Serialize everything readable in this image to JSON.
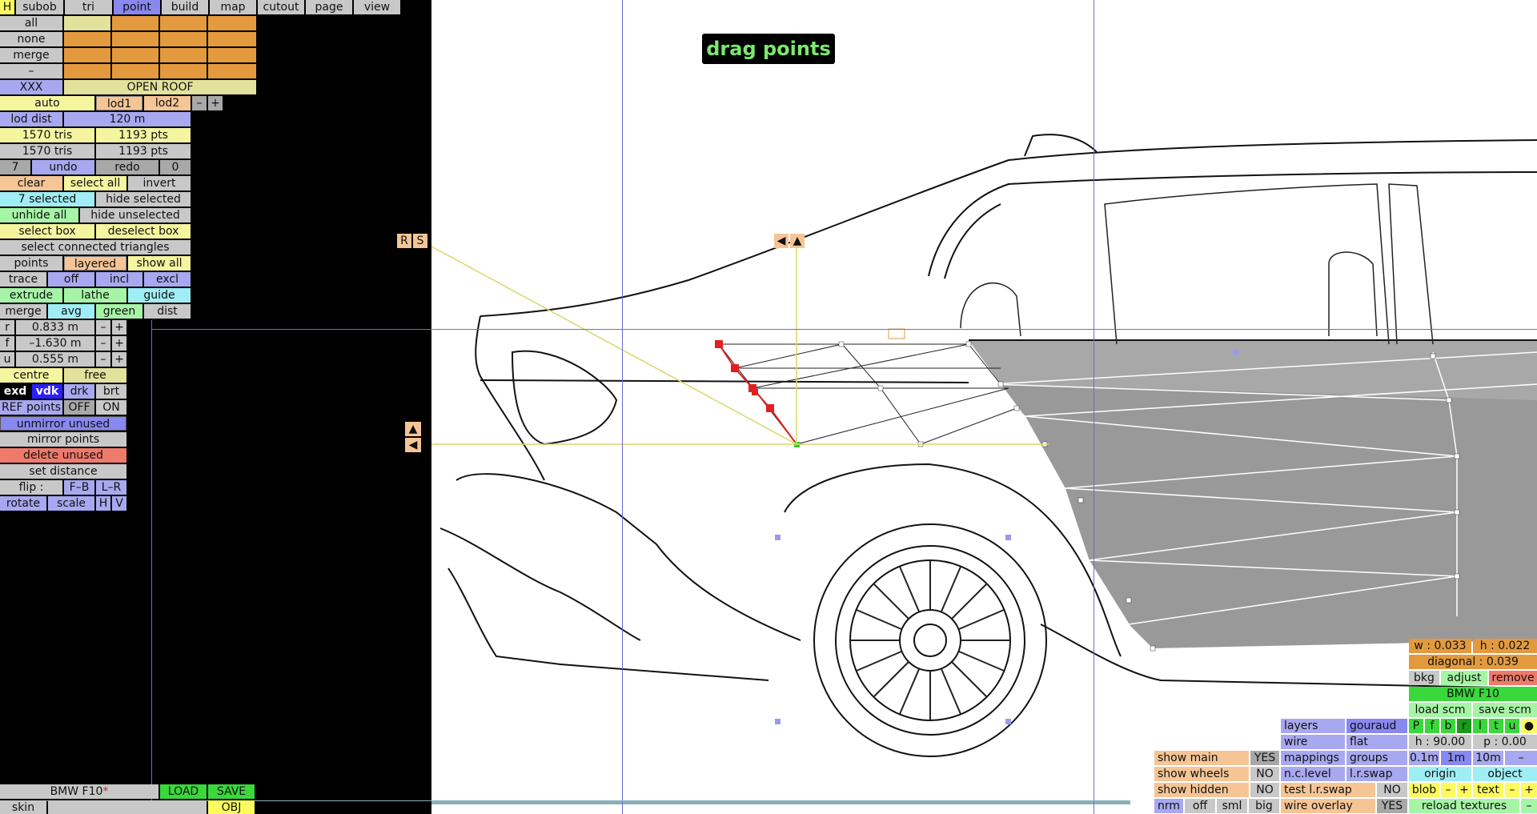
{
  "menu": {
    "h": "H",
    "tabs": [
      "subob",
      "tri",
      "point",
      "build",
      "map",
      "cutout",
      "page",
      "view"
    ],
    "active": "point"
  },
  "side": {
    "all": "all",
    "none": "none",
    "merge": "merge",
    "dash": "–",
    "xxx": "XXX",
    "open_roof": "OPEN ROOF",
    "auto": "auto",
    "lod1": "lod1",
    "lod2": "lod2",
    "minus": "–",
    "plus": "+",
    "lod_dist": "lod dist",
    "lod_dist_val": "120 m",
    "tris1": "1570 tris",
    "pts1": "1193 pts",
    "tris2": "1570 tris",
    "pts2": "1193 pts",
    "undo_n": "7",
    "undo": "undo",
    "redo": "redo",
    "redo_n": "0",
    "clear": "clear",
    "select_all": "select all",
    "invert": "invert",
    "selected": "7 selected",
    "hide_selected": "hide selected",
    "unhide_all": "unhide all",
    "hide_unselected": "hide unselected",
    "select_box": "select box",
    "deselect_box": "deselect box",
    "select_connected": "select connected triangles",
    "points": "points",
    "layered": "layered",
    "show_all": "show all",
    "trace": "trace",
    "off": "off",
    "incl": "incl",
    "excl": "excl",
    "extrude": "extrude",
    "lathe": "lathe",
    "guide": "guide",
    "merge2": "merge",
    "avg": "avg",
    "green": "green",
    "dist": "dist",
    "r": "r",
    "r_val": "0.833 m",
    "f": "f",
    "f_val": "–1.630 m",
    "u": "u",
    "u_val": "0.555 m",
    "centre": "centre",
    "free": "free",
    "exd": "exd",
    "vdk": "vdk",
    "drk": "drk",
    "brt": "brt",
    "ref_points": "REF points",
    "ref_off": "OFF",
    "ref_on": "ON",
    "unmirror": "unmirror unused",
    "mirror": "mirror points",
    "delete": "delete unused",
    "set_distance": "set distance",
    "flip": "flip :",
    "fb": "F–B",
    "lr": "L–R",
    "rotate": "rotate",
    "scale": "scale",
    "h": "H",
    "v": "V"
  },
  "bottom_left": {
    "model": "BMW F10",
    "modified_mark": "*",
    "load": "LOAD",
    "save": "SAVE",
    "skin": "skin",
    "obj": "OBJ"
  },
  "viewport": {
    "mode_label": "drag points",
    "rs_r": "R",
    "rs_s": "S",
    "arrow_left": "◀",
    "arrow_up": "▲"
  },
  "bottom_right": {
    "show_main": "show main",
    "show_main_v": "YES",
    "show_wheels": "show wheels",
    "show_wheels_v": "NO",
    "show_hidden": "show hidden",
    "show_hidden_v": "NO",
    "nrm": "nrm",
    "off": "off",
    "sml": "sml",
    "big": "big",
    "layers": "layers",
    "gouraud": "gouraud",
    "wire": "wire",
    "flat": "flat",
    "mappings": "mappings",
    "groups": "groups",
    "nc_level": "n.c.level",
    "lr_swap": "l.r.swap",
    "test_lr_swap": "test l.r.swap",
    "test_lr_swap_v": "NO",
    "wire_overlay": "wire overlay",
    "wire_overlay_v": "YES"
  },
  "right_panel": {
    "w": "w : 0.033",
    "h": "h : 0.022",
    "diagonal": "diagonal : 0.039",
    "bkg": "bkg",
    "adjust": "adjust",
    "remove": "remove",
    "model": "BMW F10",
    "load_scm": "load scm",
    "save_scm": "save scm",
    "views": [
      "P",
      "f",
      "b",
      "r",
      "l",
      "t",
      "u",
      "●"
    ],
    "h_val": "h : 90.00",
    "p_val": "p : 0.00",
    "steps": [
      "0.1m",
      "1m",
      "10m",
      "–"
    ],
    "origin": "origin",
    "object": "object",
    "blob": "blob",
    "text": "text",
    "minus": "–",
    "plus": "+",
    "reload": "reload textures",
    "dash": "–"
  },
  "colors": {
    "accent": "#8888f0",
    "orange": "#e39a3e",
    "green": "#3ad83a",
    "selected_point": "#e02020"
  }
}
